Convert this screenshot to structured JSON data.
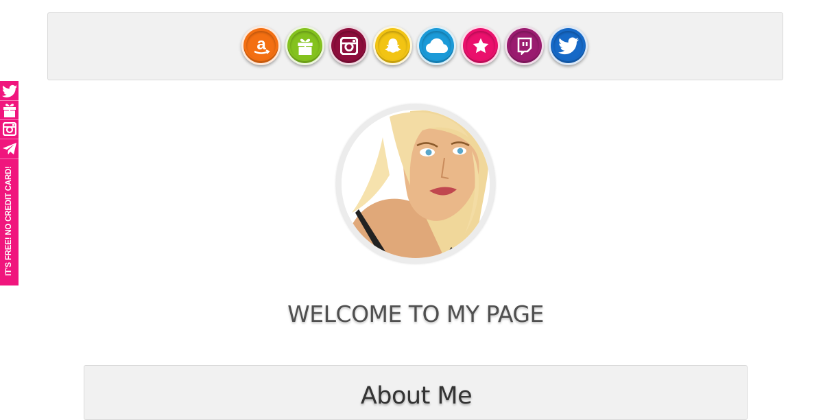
{
  "top_icons": [
    {
      "name": "amazon-icon",
      "color": "#f36f12"
    },
    {
      "name": "gift-icon",
      "color": "#84c21e"
    },
    {
      "name": "instagram-icon",
      "color": "#8e0e3c"
    },
    {
      "name": "snapchat-icon",
      "color": "#f2c413"
    },
    {
      "name": "cloud-icon",
      "color": "#1b9ad8"
    },
    {
      "name": "star-icon",
      "color": "#ea106c"
    },
    {
      "name": "twitch-icon",
      "color": "#9a1b6f"
    },
    {
      "name": "twitter-icon",
      "color": "#1669c7"
    }
  ],
  "sidebar": {
    "icons": [
      "twitter-icon",
      "gift-icon",
      "instagram-icon",
      "telegram-icon"
    ],
    "promo_text": "IT'S FREE! NO CREDIT CARD!",
    "color": "#f0157d"
  },
  "welcome_text": "WELCOME TO MY PAGE",
  "about": {
    "heading": "About Me"
  }
}
